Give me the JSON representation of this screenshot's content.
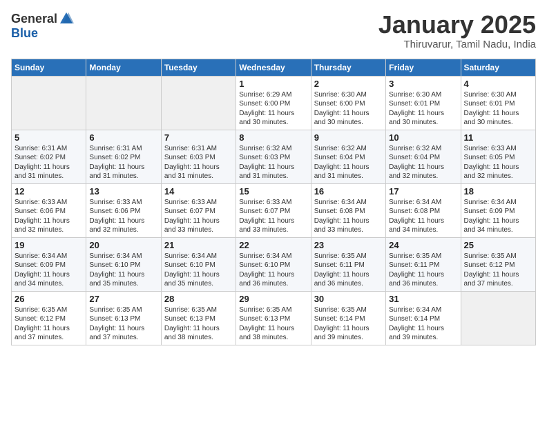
{
  "header": {
    "logo_general": "General",
    "logo_blue": "Blue",
    "month_title": "January 2025",
    "location": "Thiruvarur, Tamil Nadu, India"
  },
  "weekdays": [
    "Sunday",
    "Monday",
    "Tuesday",
    "Wednesday",
    "Thursday",
    "Friday",
    "Saturday"
  ],
  "weeks": [
    [
      {
        "day": "",
        "info": ""
      },
      {
        "day": "",
        "info": ""
      },
      {
        "day": "",
        "info": ""
      },
      {
        "day": "1",
        "info": "Sunrise: 6:29 AM\nSunset: 6:00 PM\nDaylight: 11 hours\nand 30 minutes."
      },
      {
        "day": "2",
        "info": "Sunrise: 6:30 AM\nSunset: 6:00 PM\nDaylight: 11 hours\nand 30 minutes."
      },
      {
        "day": "3",
        "info": "Sunrise: 6:30 AM\nSunset: 6:01 PM\nDaylight: 11 hours\nand 30 minutes."
      },
      {
        "day": "4",
        "info": "Sunrise: 6:30 AM\nSunset: 6:01 PM\nDaylight: 11 hours\nand 30 minutes."
      }
    ],
    [
      {
        "day": "5",
        "info": "Sunrise: 6:31 AM\nSunset: 6:02 PM\nDaylight: 11 hours\nand 31 minutes."
      },
      {
        "day": "6",
        "info": "Sunrise: 6:31 AM\nSunset: 6:02 PM\nDaylight: 11 hours\nand 31 minutes."
      },
      {
        "day": "7",
        "info": "Sunrise: 6:31 AM\nSunset: 6:03 PM\nDaylight: 11 hours\nand 31 minutes."
      },
      {
        "day": "8",
        "info": "Sunrise: 6:32 AM\nSunset: 6:03 PM\nDaylight: 11 hours\nand 31 minutes."
      },
      {
        "day": "9",
        "info": "Sunrise: 6:32 AM\nSunset: 6:04 PM\nDaylight: 11 hours\nand 31 minutes."
      },
      {
        "day": "10",
        "info": "Sunrise: 6:32 AM\nSunset: 6:04 PM\nDaylight: 11 hours\nand 32 minutes."
      },
      {
        "day": "11",
        "info": "Sunrise: 6:33 AM\nSunset: 6:05 PM\nDaylight: 11 hours\nand 32 minutes."
      }
    ],
    [
      {
        "day": "12",
        "info": "Sunrise: 6:33 AM\nSunset: 6:06 PM\nDaylight: 11 hours\nand 32 minutes."
      },
      {
        "day": "13",
        "info": "Sunrise: 6:33 AM\nSunset: 6:06 PM\nDaylight: 11 hours\nand 32 minutes."
      },
      {
        "day": "14",
        "info": "Sunrise: 6:33 AM\nSunset: 6:07 PM\nDaylight: 11 hours\nand 33 minutes."
      },
      {
        "day": "15",
        "info": "Sunrise: 6:33 AM\nSunset: 6:07 PM\nDaylight: 11 hours\nand 33 minutes."
      },
      {
        "day": "16",
        "info": "Sunrise: 6:34 AM\nSunset: 6:08 PM\nDaylight: 11 hours\nand 33 minutes."
      },
      {
        "day": "17",
        "info": "Sunrise: 6:34 AM\nSunset: 6:08 PM\nDaylight: 11 hours\nand 34 minutes."
      },
      {
        "day": "18",
        "info": "Sunrise: 6:34 AM\nSunset: 6:09 PM\nDaylight: 11 hours\nand 34 minutes."
      }
    ],
    [
      {
        "day": "19",
        "info": "Sunrise: 6:34 AM\nSunset: 6:09 PM\nDaylight: 11 hours\nand 34 minutes."
      },
      {
        "day": "20",
        "info": "Sunrise: 6:34 AM\nSunset: 6:10 PM\nDaylight: 11 hours\nand 35 minutes."
      },
      {
        "day": "21",
        "info": "Sunrise: 6:34 AM\nSunset: 6:10 PM\nDaylight: 11 hours\nand 35 minutes."
      },
      {
        "day": "22",
        "info": "Sunrise: 6:34 AM\nSunset: 6:10 PM\nDaylight: 11 hours\nand 36 minutes."
      },
      {
        "day": "23",
        "info": "Sunrise: 6:35 AM\nSunset: 6:11 PM\nDaylight: 11 hours\nand 36 minutes."
      },
      {
        "day": "24",
        "info": "Sunrise: 6:35 AM\nSunset: 6:11 PM\nDaylight: 11 hours\nand 36 minutes."
      },
      {
        "day": "25",
        "info": "Sunrise: 6:35 AM\nSunset: 6:12 PM\nDaylight: 11 hours\nand 37 minutes."
      }
    ],
    [
      {
        "day": "26",
        "info": "Sunrise: 6:35 AM\nSunset: 6:12 PM\nDaylight: 11 hours\nand 37 minutes."
      },
      {
        "day": "27",
        "info": "Sunrise: 6:35 AM\nSunset: 6:13 PM\nDaylight: 11 hours\nand 37 minutes."
      },
      {
        "day": "28",
        "info": "Sunrise: 6:35 AM\nSunset: 6:13 PM\nDaylight: 11 hours\nand 38 minutes."
      },
      {
        "day": "29",
        "info": "Sunrise: 6:35 AM\nSunset: 6:13 PM\nDaylight: 11 hours\nand 38 minutes."
      },
      {
        "day": "30",
        "info": "Sunrise: 6:35 AM\nSunset: 6:14 PM\nDaylight: 11 hours\nand 39 minutes."
      },
      {
        "day": "31",
        "info": "Sunrise: 6:34 AM\nSunset: 6:14 PM\nDaylight: 11 hours\nand 39 minutes."
      },
      {
        "day": "",
        "info": ""
      }
    ]
  ]
}
